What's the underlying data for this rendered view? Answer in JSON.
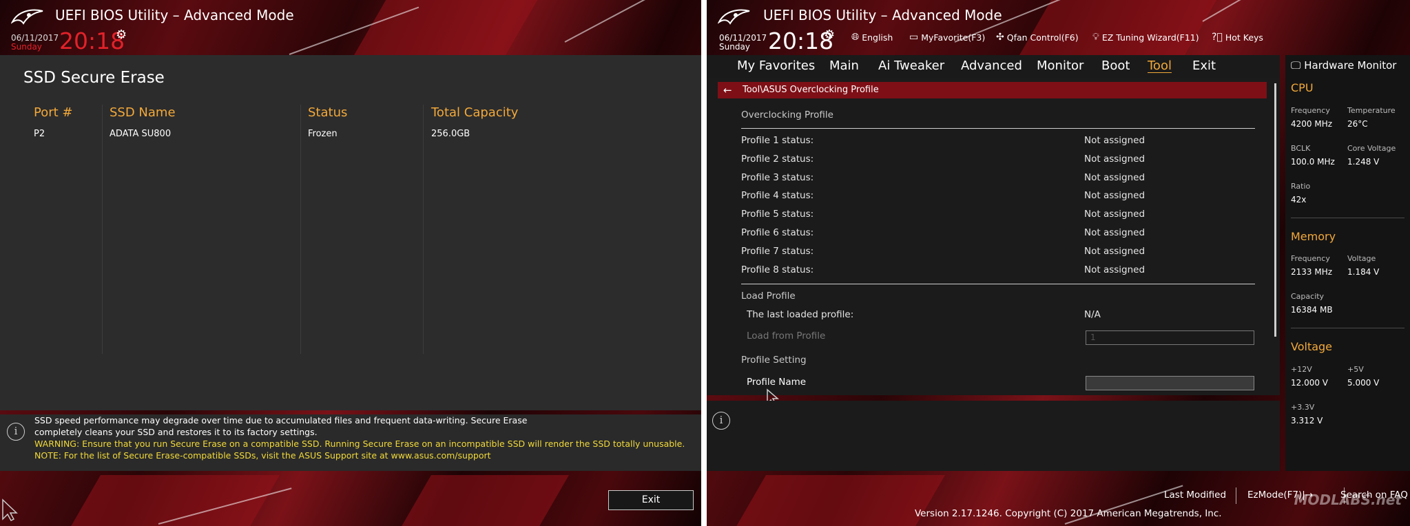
{
  "left": {
    "app_title": "UEFI BIOS Utility – Advanced Mode",
    "date": "06/11/2017",
    "day": "Sunday",
    "time": "20:18",
    "heading": "SSD Secure Erase",
    "columns": [
      "Port #",
      "SSD Name",
      "Status",
      "Total Capacity"
    ],
    "rows": [
      [
        "P2",
        "ADATA SU800",
        "Frozen",
        "256.0GB"
      ]
    ],
    "info_line1": "SSD speed performance may degrade over time due to accumulated files and frequent data-writing. Secure Erase",
    "info_line2": "completely cleans your SSD and restores it to its factory settings.",
    "warning": "WARNING: Ensure that you run Secure Erase on a compatible SSD. Running Secure Erase on an incompatible SSD will render the SSD totally unusable.",
    "note": "NOTE: For the list of Secure Erase-compatible SSDs, visit the ASUS Support site at www.asus.com/support",
    "exit_label": "Exit"
  },
  "right": {
    "app_title": "UEFI BIOS Utility – Advanced Mode",
    "date": "06/11/2017",
    "day": "Sunday",
    "time": "20:18",
    "hotkeys": {
      "language": "English",
      "myfavorite": "MyFavorite(F3)",
      "qfan": "Qfan Control(F6)",
      "ez_tuning": "EZ Tuning Wizard(F11)",
      "hotkeys": "Hot Keys"
    },
    "nav": [
      "My Favorites",
      "Main",
      "Ai Tweaker",
      "Advanced",
      "Monitor",
      "Boot",
      "Tool",
      "Exit"
    ],
    "active_nav": "Tool",
    "breadcrumb": "Tool\\ASUS Overclocking Profile",
    "section_overclocking": "Overclocking Profile",
    "profiles": [
      {
        "label": "Profile 1 status:",
        "value": "Not assigned"
      },
      {
        "label": "Profile 2 status:",
        "value": "Not assigned"
      },
      {
        "label": "Profile 3 status:",
        "value": "Not assigned"
      },
      {
        "label": "Profile 4 status:",
        "value": "Not assigned"
      },
      {
        "label": "Profile 5 status:",
        "value": "Not assigned"
      },
      {
        "label": "Profile 6 status:",
        "value": "Not assigned"
      },
      {
        "label": "Profile 7 status:",
        "value": "Not assigned"
      },
      {
        "label": "Profile 8 status:",
        "value": "Not assigned"
      }
    ],
    "section_load": "Load Profile",
    "last_loaded_label": "The last loaded profile:",
    "last_loaded_value": "N/A",
    "load_from_label": "Load from Profile",
    "load_from_value": "1",
    "section_setting": "Profile Setting",
    "profile_name_label": "Profile Name",
    "profile_name_value": "",
    "footer": {
      "last_modified": "Last Modified",
      "ezmode": "EzMode(F7)|→",
      "search": "Search on FAQ",
      "copyright": "Version 2.17.1246. Copyright (C) 2017 American Megatrends, Inc.",
      "watermark": "MODLABS.net"
    }
  },
  "hardware_monitor": {
    "title": "Hardware Monitor",
    "cpu": {
      "heading": "CPU",
      "frequency_label": "Frequency",
      "frequency": "4200 MHz",
      "temperature_label": "Temperature",
      "temperature": "26°C",
      "bclk_label": "BCLK",
      "bclk": "100.0 MHz",
      "core_voltage_label": "Core Voltage",
      "core_voltage": "1.248 V",
      "ratio_label": "Ratio",
      "ratio": "42x"
    },
    "memory": {
      "heading": "Memory",
      "frequency_label": "Frequency",
      "frequency": "2133 MHz",
      "voltage_label": "Voltage",
      "voltage": "1.184 V",
      "capacity_label": "Capacity",
      "capacity": "16384 MB"
    },
    "voltage": {
      "heading": "Voltage",
      "v12_label": "+12V",
      "v12": "12.000 V",
      "v5_label": "+5V",
      "v5": "5.000 V",
      "v33_label": "+3.3V",
      "v33": "3.312 V"
    }
  },
  "colors": {
    "accent_orange": "#f3a93a",
    "clock_red": "#e2222a",
    "warning_yellow": "#f1d93a",
    "breadcrumb_red": "#7e0f16"
  }
}
